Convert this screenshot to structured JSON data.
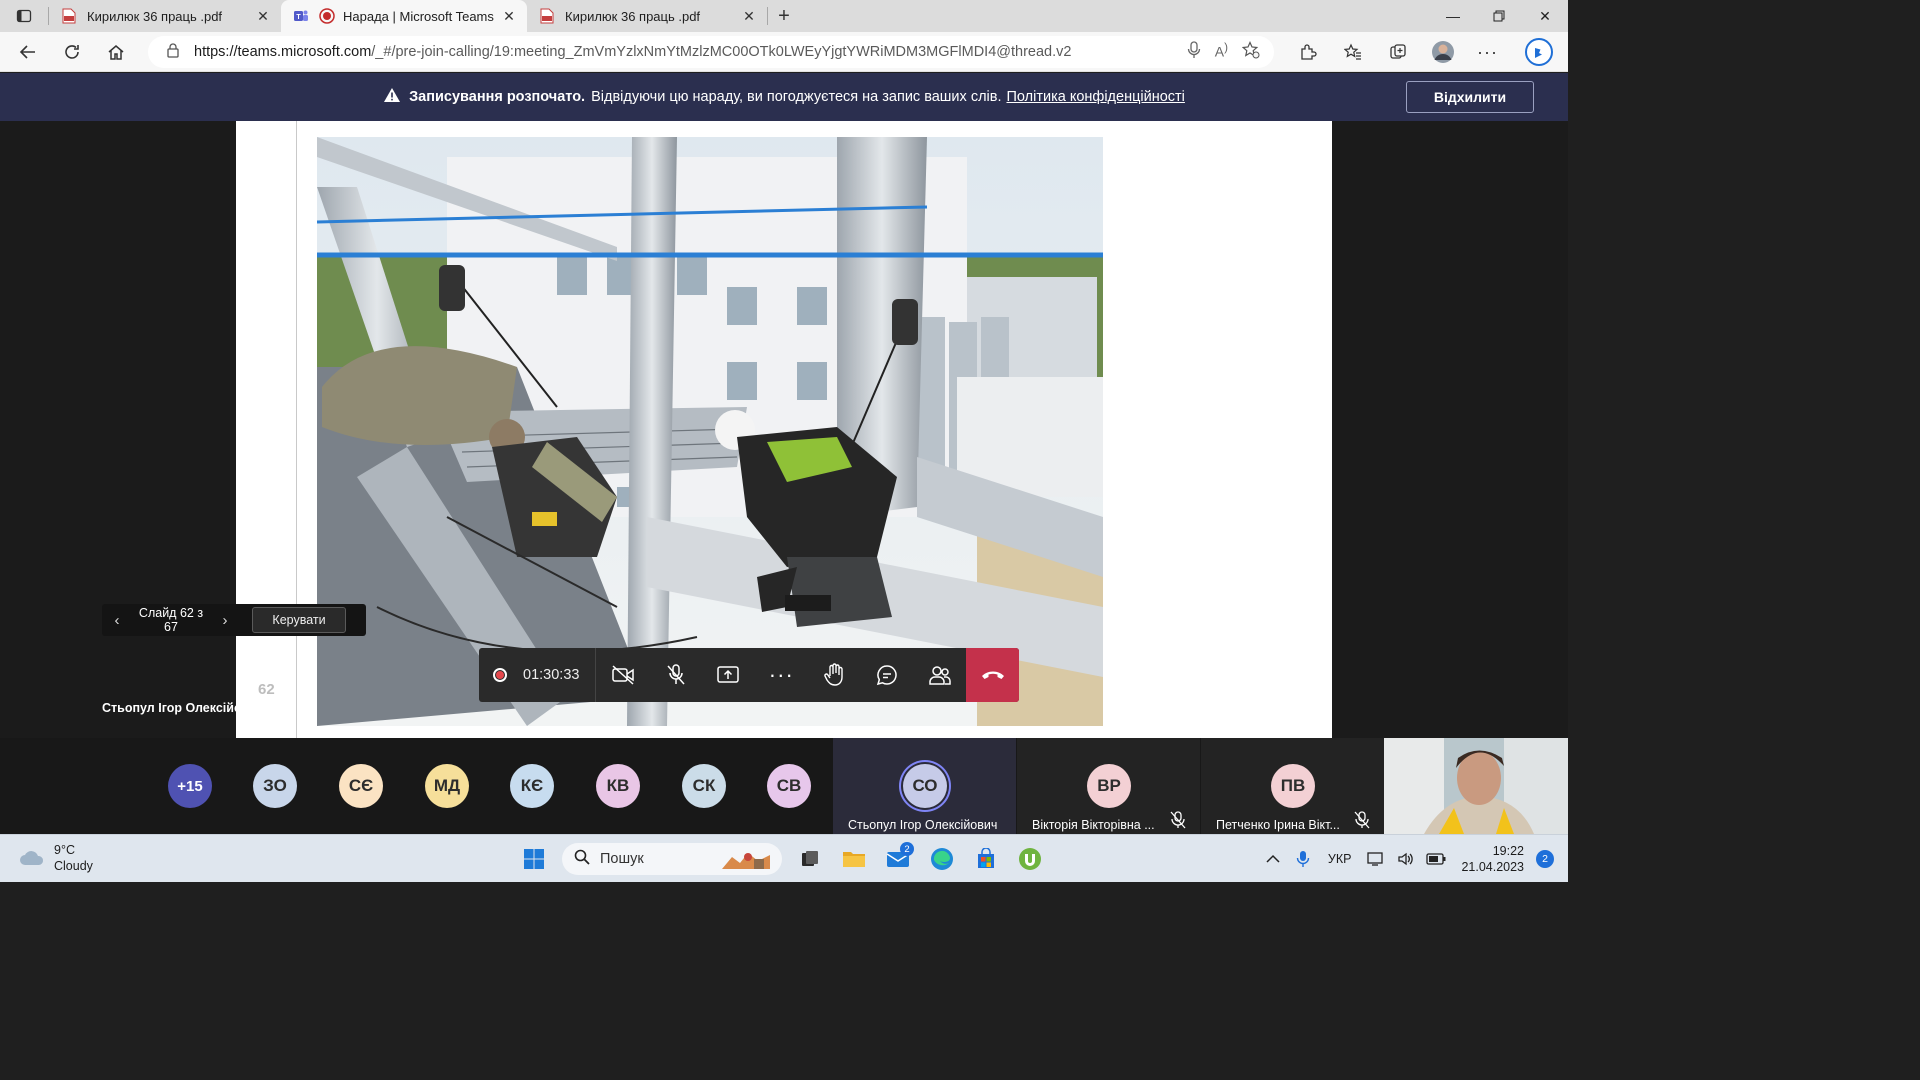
{
  "browser": {
    "tabs": [
      {
        "label": "Кирилюк 36 праць .pdf",
        "icon": "pdf-icon"
      },
      {
        "label": "Нарада | Microsoft Teams",
        "icon": "teams-icon",
        "active": true
      },
      {
        "label": "Кирилюк 36 праць .pdf",
        "icon": "pdf-icon"
      }
    ],
    "url_host": "https://teams.microsoft.com",
    "url_path": "/_#/pre-join-calling/19:meeting_ZmVmYzlxNmYtMzlzMC00OTk0LWEyYjgtYWRiMDM3MGFlMDI4@thread.v2"
  },
  "banner": {
    "strong": "Записування розпочато.",
    "text": "Відвідуючи цю нараду, ви погоджуєтеся на запис ваших слів.",
    "policy": "Політика конфіденційності",
    "decline": "Відхилити",
    "bg": "#2b2f4f"
  },
  "slide": {
    "page_number": "62",
    "nav_count": "Слайд 62 з 67",
    "control_button": "Керувати",
    "presenter": "Стьопул Ігор Олексійович"
  },
  "callbar": {
    "timer": "01:30:33",
    "leave_color": "#c4314b"
  },
  "participants": {
    "overflow": "+15",
    "avatars": [
      {
        "initials": "ЗО",
        "color": "#c8d6ea"
      },
      {
        "initials": "СЄ",
        "color": "#fbe3c3"
      },
      {
        "initials": "МД",
        "color": "#f6df9a"
      },
      {
        "initials": "КЄ",
        "color": "#c7dcef"
      },
      {
        "initials": "КВ",
        "color": "#e9c6e6"
      },
      {
        "initials": "СК",
        "color": "#cbdce8"
      },
      {
        "initials": "СВ",
        "color": "#e7c7eb"
      }
    ],
    "tiles": [
      {
        "initials": "СО",
        "name": "Стьопул Ігор Олексійович",
        "color": "#c6cbe8"
      },
      {
        "initials": "ВР",
        "name": "Вікторія Вікторівна ...",
        "color": "#f3d0d4"
      },
      {
        "initials": "ПВ",
        "name": "Петченко Ірина Вікт...",
        "color": "#f3d0d4"
      }
    ]
  },
  "taskbar": {
    "temp": "9°C",
    "condition": "Cloudy",
    "search": "Пошук",
    "mail_badge": "2",
    "language": "УКР",
    "time": "19:22",
    "date": "21.04.2023",
    "notifications": "2"
  }
}
